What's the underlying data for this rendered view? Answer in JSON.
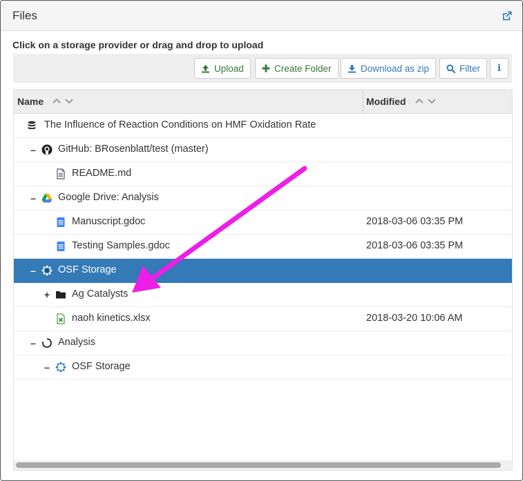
{
  "panel": {
    "title": "Files",
    "icon": "external-link-icon"
  },
  "hint": "Click on a storage provider or drag and drop to upload",
  "toolbar": {
    "upload": "Upload",
    "create_folder": "Create Folder",
    "download_zip": "Download as zip",
    "filter": "Filter",
    "info": "i"
  },
  "columns": {
    "name": "Name",
    "modified": "Modified"
  },
  "rows": [
    {
      "label": "The Influence of Reaction Conditions on HMF Oxidation Rate",
      "toggle": "",
      "icon": "database-icon",
      "date": ""
    },
    {
      "label": "GitHub: BRosenblatt/test (master)",
      "toggle": "–",
      "icon": "github-icon",
      "date": ""
    },
    {
      "label": "README.md",
      "toggle": "",
      "icon": "file-text-icon",
      "date": ""
    },
    {
      "label": "Google Drive: Analysis",
      "toggle": "–",
      "icon": "google-drive-icon",
      "date": ""
    },
    {
      "label": "Manuscript.gdoc",
      "toggle": "",
      "icon": "gdoc-icon",
      "date": "2018-03-06 03:35 PM"
    },
    {
      "label": "Testing Samples.gdoc",
      "toggle": "",
      "icon": "gdoc-icon",
      "date": "2018-03-06 03:35 PM"
    },
    {
      "label": "OSF Storage",
      "toggle": "–",
      "icon": "osf-storage-icon",
      "date": ""
    },
    {
      "label": "Ag Catalysts",
      "toggle": "+",
      "icon": "folder-icon",
      "date": ""
    },
    {
      "label": "naoh kinetics.xlsx",
      "toggle": "",
      "icon": "spreadsheet-icon",
      "date": "2018-03-20 10:06 AM"
    },
    {
      "label": "Analysis",
      "toggle": "–",
      "icon": "component-circle-icon",
      "date": ""
    },
    {
      "label": "OSF Storage",
      "toggle": "–",
      "icon": "osf-storage-icon",
      "date": ""
    }
  ],
  "colors": {
    "selected": "#337ab7",
    "annotation": "#ee1ee8"
  }
}
